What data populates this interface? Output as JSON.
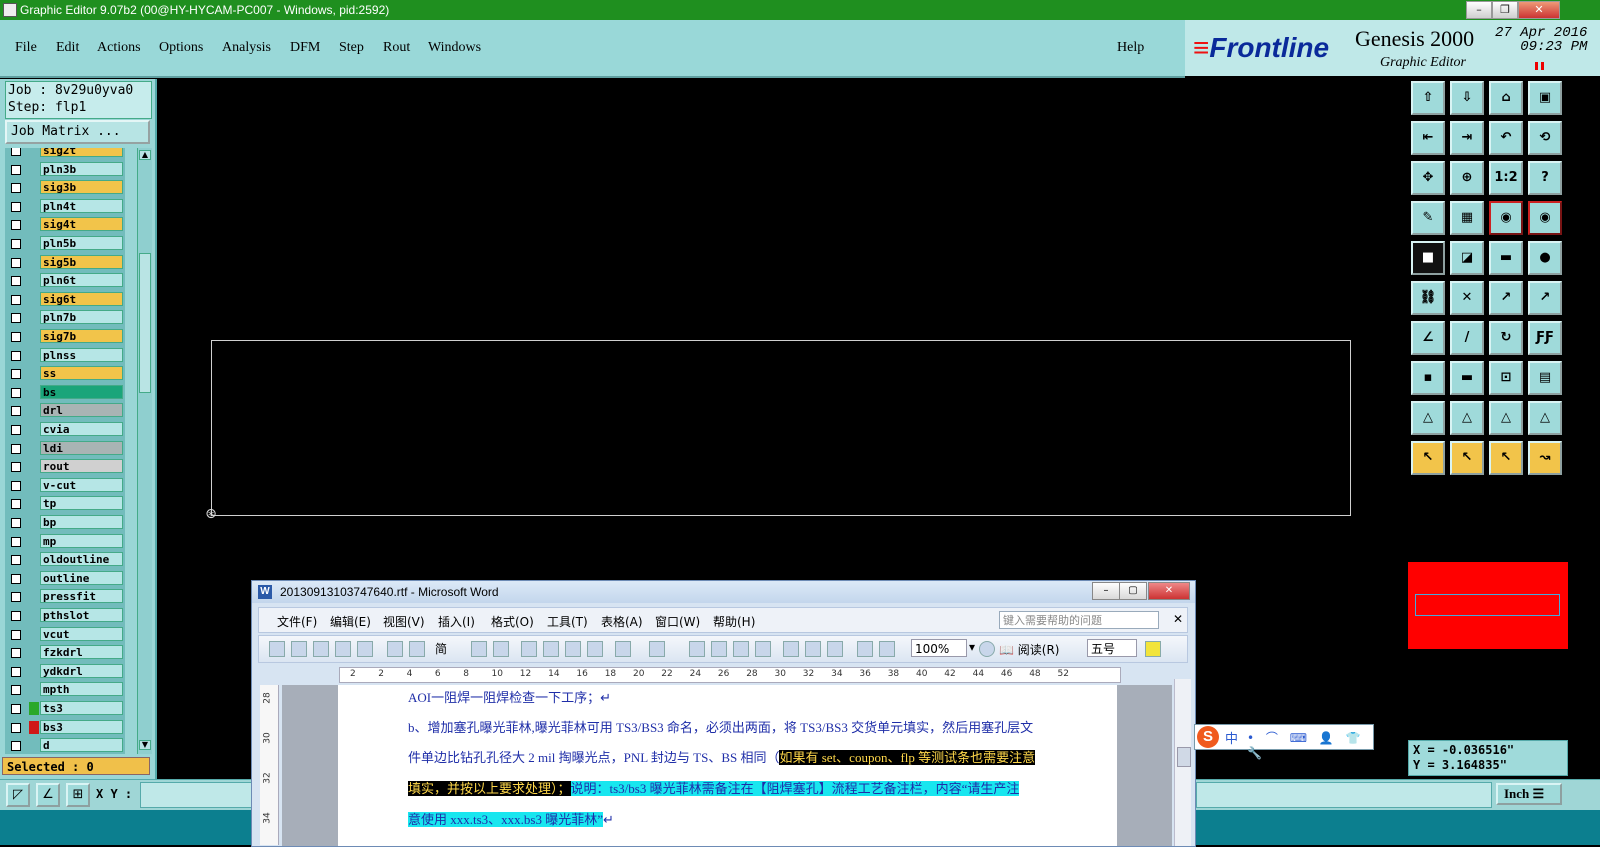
{
  "window": {
    "title": "Graphic Editor 9.07b2 (00@HY-HYCAM-PC007 - Windows, pid:2592)",
    "controls": {
      "minimize": "–",
      "restore": "❐",
      "close": "✕"
    }
  },
  "menubar": {
    "items": [
      "File",
      "Edit",
      "Actions",
      "Options",
      "Analysis",
      "DFM",
      "Step",
      "Rout",
      "Windows"
    ],
    "help": "Help"
  },
  "brand": {
    "logo": "Frontline",
    "product": "Genesis 2000",
    "subtitle": "Graphic Editor",
    "date": "27 Apr 2016",
    "time": "09:23 PM"
  },
  "job": {
    "job_line": "Job : 8v29u0yva0",
    "step_line": "Step: flp1",
    "matrix_button": "Job Matrix ..."
  },
  "layers": [
    {
      "name": "sig2t",
      "color": "#f2c44a",
      "swatch": ""
    },
    {
      "name": "pln3b",
      "color": "#b6e6e6",
      "swatch": ""
    },
    {
      "name": "sig3b",
      "color": "#f2c44a",
      "swatch": ""
    },
    {
      "name": "pln4t",
      "color": "#b6e6e6",
      "swatch": ""
    },
    {
      "name": "sig4t",
      "color": "#f2c44a",
      "swatch": ""
    },
    {
      "name": "pln5b",
      "color": "#b6e6e6",
      "swatch": ""
    },
    {
      "name": "sig5b",
      "color": "#f2c44a",
      "swatch": ""
    },
    {
      "name": "pln6t",
      "color": "#b6e6e6",
      "swatch": ""
    },
    {
      "name": "sig6t",
      "color": "#f2c44a",
      "swatch": ""
    },
    {
      "name": "pln7b",
      "color": "#b6e6e6",
      "swatch": ""
    },
    {
      "name": "sig7b",
      "color": "#f2c44a",
      "swatch": ""
    },
    {
      "name": "plnss",
      "color": "#b6e6e6",
      "swatch": ""
    },
    {
      "name": "ss",
      "color": "#f2c44a",
      "swatch": ""
    },
    {
      "name": "bs",
      "color": "#1aa57a",
      "swatch": ""
    },
    {
      "name": "drl",
      "color": "#a9b4b4",
      "swatch": ""
    },
    {
      "name": "cvia",
      "color": "#b6e6e6",
      "swatch": ""
    },
    {
      "name": "ldi",
      "color": "#a9b4b4",
      "swatch": ""
    },
    {
      "name": "rout",
      "color": "#d0d0d0",
      "swatch": ""
    },
    {
      "name": "v-cut",
      "color": "#b6e6e6",
      "swatch": ""
    },
    {
      "name": "tp",
      "color": "#b6e6e6",
      "swatch": ""
    },
    {
      "name": "bp",
      "color": "#b6e6e6",
      "swatch": ""
    },
    {
      "name": "mp",
      "color": "#b6e6e6",
      "swatch": ""
    },
    {
      "name": "oldoutline",
      "color": "#b6e6e6",
      "swatch": ""
    },
    {
      "name": "outline",
      "color": "#b6e6e6",
      "swatch": ""
    },
    {
      "name": "pressfit",
      "color": "#b6e6e6",
      "swatch": ""
    },
    {
      "name": "pthslot",
      "color": "#b6e6e6",
      "swatch": ""
    },
    {
      "name": "vcut",
      "color": "#b6e6e6",
      "swatch": ""
    },
    {
      "name": "fzkdrl",
      "color": "#b6e6e6",
      "swatch": ""
    },
    {
      "name": "ydkdrl",
      "color": "#b6e6e6",
      "swatch": ""
    },
    {
      "name": "mpth",
      "color": "#b6e6e6",
      "swatch": ""
    },
    {
      "name": "ts3",
      "color": "#b6e6e6",
      "swatch": "#2aa82a"
    },
    {
      "name": "bs3",
      "color": "#b6e6e6",
      "swatch": "#d01818"
    },
    {
      "name": "d",
      "color": "#b6e6e6",
      "swatch": ""
    }
  ],
  "status": {
    "selected": "Selected : 0",
    "x": "X = -0.036516\"",
    "y": "Y = 3.164835\""
  },
  "bottom": {
    "xy_label": "X Y :",
    "units": "Inch"
  },
  "tool_icons": [
    "layer-up-icon",
    "layer-down-icon",
    "home-icon",
    "window-icon",
    "pan-left-icon",
    "pan-right-icon",
    "undo-view-icon",
    "redraw-icon",
    "zoom-fit-icon",
    "zoom-center-icon",
    "scale-1to2-icon",
    "query-icon",
    "measure-icon",
    "grid-icon",
    "snap-icon",
    "snap-alt-icon",
    "pad-icon",
    "line-icon",
    "ruler-icon",
    "dot-icon",
    "connect-icon",
    "cross-icon",
    "point-to-point-icon",
    "arrow-point-icon",
    "edge-icon",
    "line-red-icon",
    "arc-icon",
    "text-ff-icon",
    "pad-select-icon",
    "bar-icon",
    "dimension-icon",
    "group-icon",
    "triangle-1-icon",
    "triangle-2-icon",
    "triangle-3-icon",
    "triangle-4-icon",
    "select-icon",
    "select-box-icon",
    "select-net-icon",
    "route-icon"
  ],
  "tool_labels": {
    "scale": "1:2",
    "query": "?"
  },
  "word": {
    "title": "20130913103747640.rtf - Microsoft Word",
    "menu": [
      "文件(F)",
      "编辑(E)",
      "视图(V)",
      "插入(I)",
      "格式(O)",
      "工具(T)",
      "表格(A)",
      "窗口(W)",
      "帮助(H)"
    ],
    "help_placeholder": "键入需要帮助的问题",
    "zoom": "100%",
    "read_button": "阅读(R)",
    "font_size": "五号",
    "font_style": "简",
    "ruler_ticks": [
      "2",
      "2",
      "4",
      "6",
      "8",
      "10",
      "12",
      "14",
      "16",
      "18",
      "20",
      "22",
      "24",
      "26",
      "28",
      "30",
      "32",
      "34",
      "36",
      "38",
      "40",
      "42",
      "44",
      "46",
      "48",
      "52"
    ],
    "vruler_ticks": [
      "28",
      "30",
      "32",
      "34"
    ],
    "line1": "AOI一阻焊一阻焊检查一下工序；↵",
    "line2": "b、增加塞孔曝光菲林,曝光菲林可用 TS3/BS3 命名，必须出两面，将 TS3/BS3 交货单元填实，然后用塞孔层文",
    "line3a": "件单边比钻孔孔径大 2 mil 掏曝光点，PNL 封边与 TS、BS 相同（",
    "line3b": "如果有 set、coupon、flp 等测试条也需要注意",
    "line4a": "填实，并按以上要求处理）；",
    "line4b": "说明：ts3/bs3 曝光菲林需备注在【阻焊塞孔】流程工艺备注栏，内容“请生产注",
    "line5": "意使用 xxx.ts3、xxx.bs3 曝光菲林”",
    "line5b": "↵"
  },
  "ime": {
    "logo": "S",
    "lang": "中",
    "glyphs": "• ⌒ ⌨ 👤 👕 🔧"
  }
}
